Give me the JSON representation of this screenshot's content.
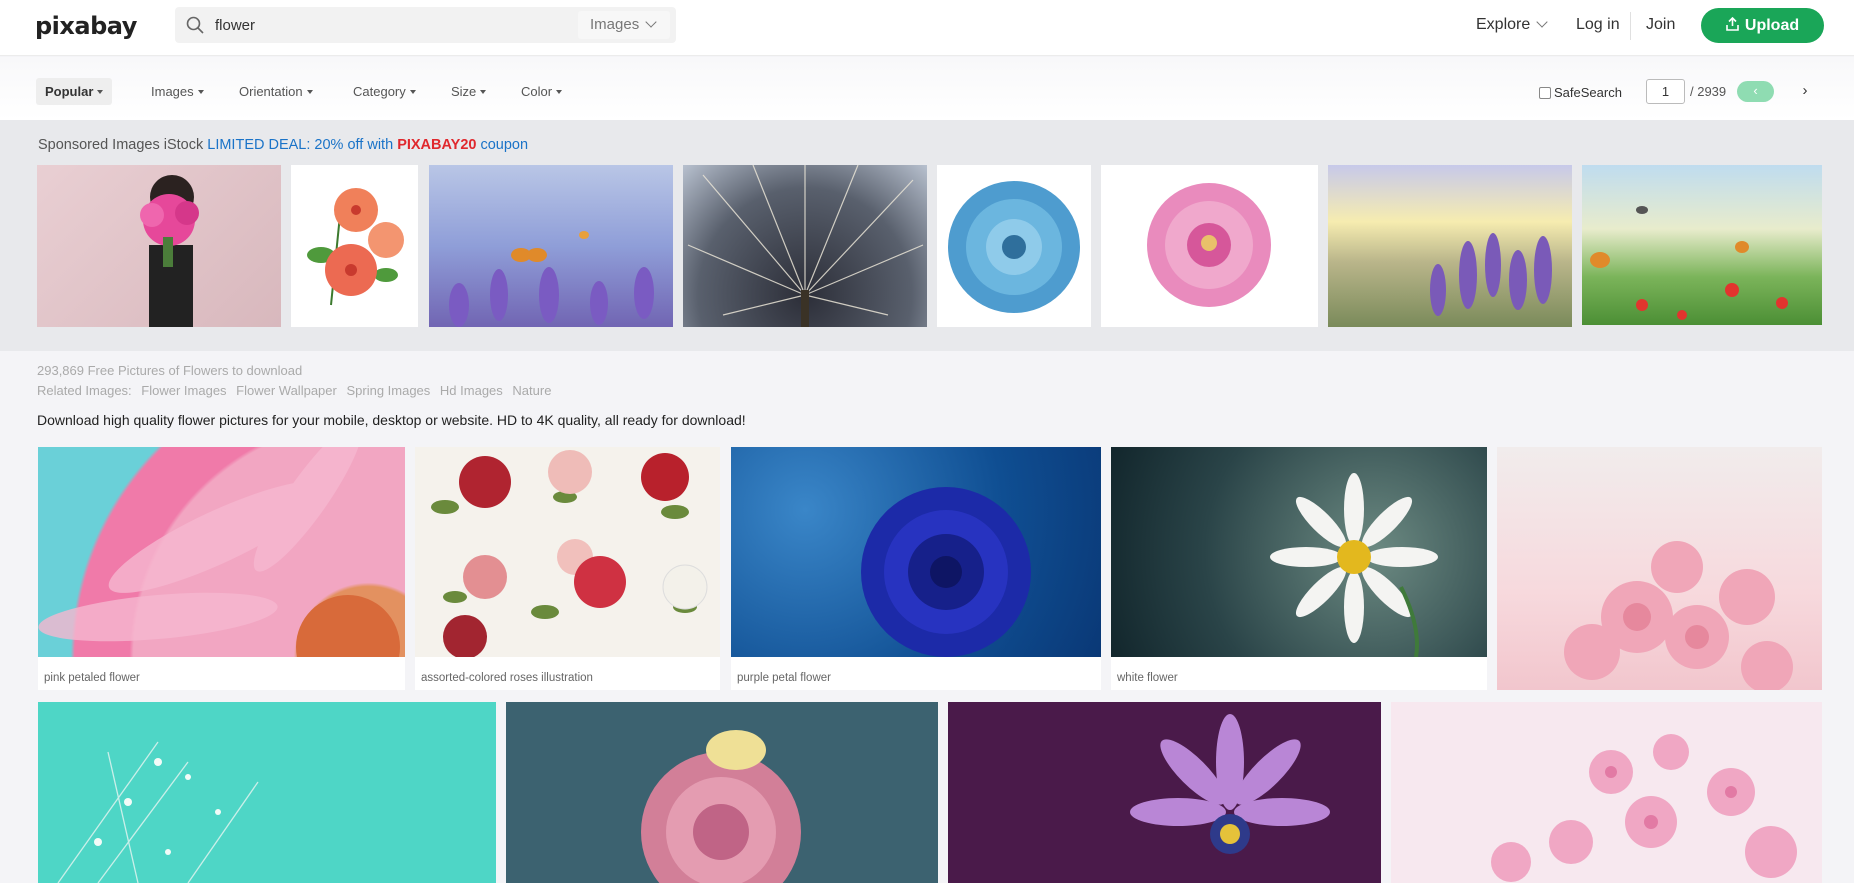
{
  "header": {
    "logo": "pixabay",
    "search_value": "flower",
    "search_type": "Images",
    "explore": "Explore",
    "login": "Log in",
    "join": "Join",
    "upload": "Upload",
    "brand_color": "#1aa658"
  },
  "filters": {
    "items": [
      "Popular",
      "Images",
      "Orientation",
      "Category",
      "Size",
      "Color"
    ],
    "safesearch": "SafeSearch",
    "page": "1",
    "page_total": "/ 2939"
  },
  "sponsored": {
    "prefix": "Sponsored Images iStock",
    "deal": "LIMITED DEAL: 20% off with",
    "code": "PIXABAY20",
    "suffix": "coupon",
    "thumbs": [
      "woman-holding-pink-bouquet",
      "orange-hibiscus",
      "lavender-butterflies",
      "dandelion-macro",
      "blue-dahlia",
      "pink-dahlia",
      "lavender-sunset",
      "meadow-butterflies"
    ]
  },
  "info": {
    "count": "293,869 Free Pictures of Flowers to download",
    "related_label": "Related Images:",
    "related": [
      "Flower Images",
      "Flower Wallpaper",
      "Spring Images",
      "Hd Images",
      "Nature"
    ],
    "description": "Download high quality flower pictures for your mobile, desktop or website. HD to 4K quality, all ready for download!"
  },
  "results": {
    "row1": [
      {
        "caption": "pink petaled flower"
      },
      {
        "caption": "assorted-colored roses illustration"
      },
      {
        "caption": "purple petal flower"
      },
      {
        "caption": "white flower"
      },
      {
        "caption": ""
      }
    ]
  }
}
